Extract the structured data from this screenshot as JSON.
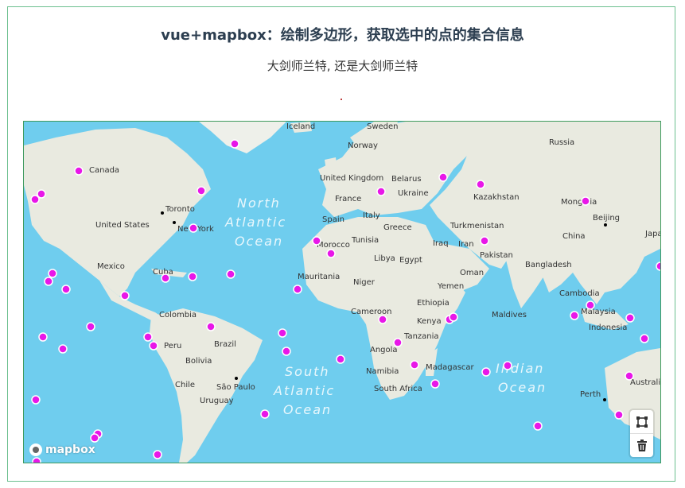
{
  "page": {
    "title": "vue+mapbox：绘制多边形，获取选中的点的集合信息",
    "subtitle": "大剑师兰特, 还是大剑师兰特"
  },
  "map": {
    "attribution_logo": "mapbox",
    "ocean_labels": [
      {
        "text": "North"
      },
      {
        "text": "Atlantic"
      },
      {
        "text": "Ocean"
      },
      {
        "text": "South"
      },
      {
        "text": "Atlantic"
      },
      {
        "text": "Ocean"
      },
      {
        "text": "Indian"
      },
      {
        "text": "Ocean"
      }
    ],
    "place_labels": [
      "Iceland",
      "Sweden",
      "Norway",
      "Russia",
      "Canada",
      "United Kingdom",
      "Belarus",
      "Ukraine",
      "France",
      "Kazakhstan",
      "Mongolia",
      "Toronto",
      "United States",
      "New York",
      "Spain",
      "Italy",
      "Greece",
      "Turkmenistan",
      "Beijing",
      "Morocco",
      "Tunisia",
      "Iraq",
      "Iran",
      "China",
      "Japan",
      "Mexico",
      "Cuba",
      "Libya",
      "Egypt",
      "Pakistan",
      "Bangladesh",
      "Mauritania",
      "Niger",
      "Oman",
      "Yemen",
      "Cambodia",
      "Colombia",
      "Cameroon",
      "Ethiopia",
      "Kenya",
      "Malaysia",
      "Indonesia",
      "Peru",
      "Brazil",
      "Tanzania",
      "Angola",
      "Bolivia",
      "Namibia",
      "Madagascar",
      "Chile",
      "São Paulo",
      "Uruguay",
      "South Africa",
      "Perth",
      "Australia",
      "Maldives"
    ],
    "marker_color": "#e817e8",
    "colors": {
      "water": "#6fcdee",
      "land": "#e9eae0",
      "ice": "#f6f7f3"
    }
  },
  "controls": {
    "draw_polygon": "polygon-draw-icon",
    "trash": "trash-icon"
  }
}
